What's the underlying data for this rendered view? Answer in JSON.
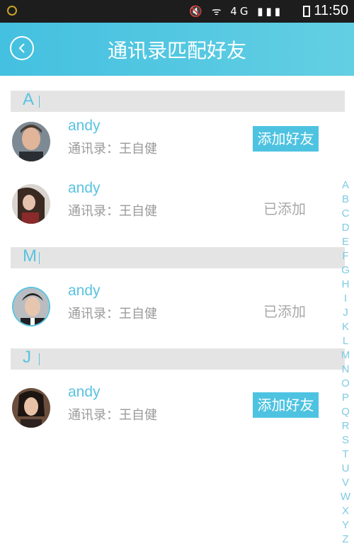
{
  "status": {
    "network": "4G",
    "time": "11:50"
  },
  "header": {
    "title": "通讯录匹配好友"
  },
  "sections": [
    {
      "letter": "A",
      "contacts": [
        {
          "name": "andy",
          "sub": "通讯录：王自健",
          "action": "添加好友",
          "added": false
        },
        {
          "name": "andy",
          "sub": "通讯录：王自健",
          "action": "已添加",
          "added": true
        }
      ]
    },
    {
      "letter": "M",
      "contacts": [
        {
          "name": "andy",
          "sub": "通讯录：王自健",
          "action": "已添加",
          "added": true
        }
      ]
    },
    {
      "letter": "J",
      "contacts": [
        {
          "name": "andy",
          "sub": "通讯录：王自健",
          "action": "添加好友",
          "added": false
        }
      ]
    }
  ],
  "alphabet": [
    "A",
    "B",
    "C",
    "D",
    "E",
    "F",
    "G",
    "H",
    "I",
    "J",
    "K",
    "L",
    "M",
    "N",
    "O",
    "P",
    "Q",
    "R",
    "S",
    "T",
    "U",
    "V",
    "W",
    "X",
    "Y",
    "Z"
  ],
  "colors": {
    "accent": "#4ec3e1",
    "header_start": "#44c0e0",
    "header_end": "#63cfe3",
    "section_bg": "#e4e4e4"
  }
}
